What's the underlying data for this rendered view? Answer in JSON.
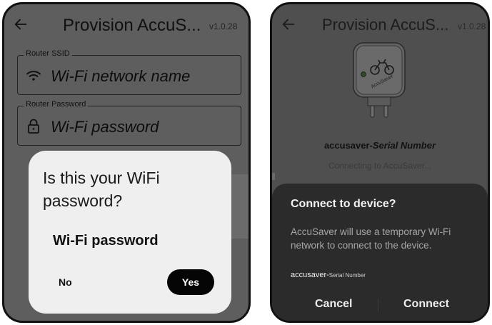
{
  "left": {
    "title": "Provision AccuS...",
    "version": "v1.0.28",
    "ssid": {
      "label": "Router SSID",
      "value": "Wi-Fi network name"
    },
    "password": {
      "label": "Router Password",
      "value": "Wi-Fi password"
    },
    "dialog": {
      "title": "Is this your WiFi password?",
      "value": "Wi-Fi password",
      "no": "No",
      "yes": "Yes"
    }
  },
  "right": {
    "title": "Provision AccuS...",
    "version": "v1.0.28",
    "device_name": "accusaver-",
    "device_serial": "Serial Number",
    "status": "Connecting to AccuSaver...",
    "dialog": {
      "title": "Connect to device?",
      "body": "AccuSaver will use a temporary Wi-Fi network to connect to the device.",
      "serial_prefix": "accusaver-",
      "serial_suffix": "Serial Number",
      "cancel": "Cancel",
      "connect": "Connect"
    }
  },
  "device_logo_text": "AccuSaver",
  "icons": [
    "back-arrow-icon",
    "wifi-icon",
    "lock-icon",
    "smart-plug-device-icon"
  ],
  "colors": {
    "overlay": "#5e5e5e",
    "dialog_light": "#efefef",
    "dialog_dark": "#2b2b2b",
    "primary_button": "#050505"
  }
}
